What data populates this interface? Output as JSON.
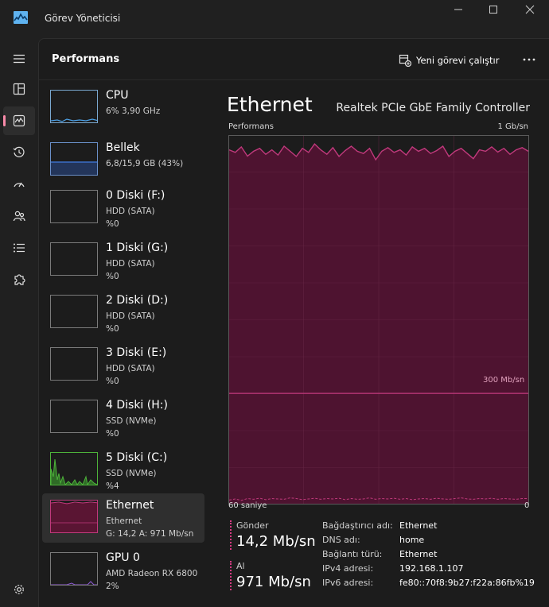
{
  "window": {
    "title": "Görev Yöneticisi"
  },
  "header": {
    "title": "Performans",
    "run_task_label": "Yeni görevi çalıştır"
  },
  "colors": {
    "accent": "#f98aa9",
    "ethernet": "#c0397c",
    "cpu": "#4da2e8",
    "memory": "#3a6ec8",
    "disk_active": "#4db33a"
  },
  "sidebar": {
    "items": [
      {
        "name": "CPU",
        "lines": [
          "6%  3,90 GHz"
        ]
      },
      {
        "name": "Bellek",
        "lines": [
          "6,8/15,9 GB (43%)"
        ]
      },
      {
        "name": "0 Diski (F:)",
        "lines": [
          "HDD (SATA)",
          "%0"
        ]
      },
      {
        "name": "1 Diski (G:)",
        "lines": [
          "HDD (SATA)",
          "%0"
        ]
      },
      {
        "name": "2 Diski (D:)",
        "lines": [
          "HDD (SATA)",
          "%0"
        ]
      },
      {
        "name": "3 Diski (E:)",
        "lines": [
          "HDD (SATA)",
          "%0"
        ]
      },
      {
        "name": "4 Diski (H:)",
        "lines": [
          "SSD (NVMe)",
          "%0"
        ]
      },
      {
        "name": "5 Diski (C:)",
        "lines": [
          "SSD (NVMe)",
          "%4"
        ]
      },
      {
        "name": "Ethernet",
        "lines": [
          "Ethernet",
          "G: 14,2  A: 971 Mb/sn"
        ]
      },
      {
        "name": "GPU 0",
        "lines": [
          "AMD Radeon RX 6800",
          "2%"
        ]
      }
    ]
  },
  "detail": {
    "title": "Ethernet",
    "adapter": "Realtek PCIe GbE Family Controller",
    "graph_top_left": "Performans",
    "graph_top_right": "1 Gb/sn",
    "graph_mid_label": "300 Mb/sn",
    "graph_bottom_left": "60 saniye",
    "graph_bottom_right": "0",
    "send_label": "Gönder",
    "send_value": "14,2 Mb/sn",
    "receive_label": "Al",
    "receive_value": "971 Mb/sn",
    "info": [
      {
        "key": "Bağdaştırıcı adı:",
        "value": "Ethernet"
      },
      {
        "key": "DNS adı:",
        "value": "home"
      },
      {
        "key": "Bağlantı türü:",
        "value": "Ethernet"
      },
      {
        "key": "IPv4 adresi:",
        "value": "192.168.1.107"
      },
      {
        "key": "IPv6 adresi:",
        "value": "fe80::70f8:9b27:f22a:86fb%19"
      }
    ]
  },
  "chart_data": {
    "type": "area",
    "ylim": [
      0,
      1000
    ],
    "series": [
      {
        "values": [
          962,
          955,
          970,
          945,
          958,
          966,
          950,
          962,
          948,
          972,
          958,
          944,
          966,
          955,
          978,
          962,
          950,
          968,
          944,
          960,
          972,
          958,
          952,
          966,
          935,
          958,
          968,
          955,
          962,
          948,
          970,
          958,
          966,
          952,
          960,
          972,
          944,
          958,
          966,
          952,
          938,
          962,
          958,
          970,
          956,
          966,
          950,
          962,
          968,
          958
        ]
      },
      {
        "values": [
          10,
          13,
          9,
          14,
          12,
          15,
          11,
          14,
          13,
          12,
          16,
          14,
          11,
          13,
          15,
          12,
          14,
          13,
          15,
          11,
          14,
          12,
          13,
          16,
          12,
          14,
          13,
          15,
          12,
          14,
          11,
          13,
          14,
          12,
          15,
          13,
          12,
          14,
          16,
          13,
          12,
          14,
          13,
          15,
          12,
          14,
          13,
          12,
          14,
          14
        ]
      }
    ]
  }
}
